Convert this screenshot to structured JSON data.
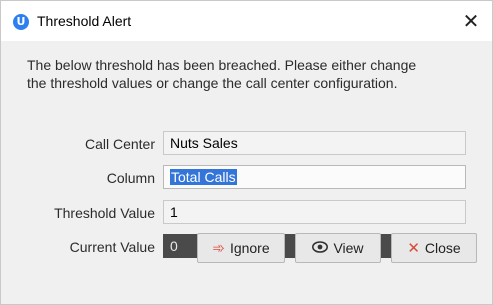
{
  "window": {
    "title": "Threshold Alert",
    "app_icon_letter": "U",
    "close_glyph": "✕"
  },
  "message": {
    "line1": "The below threshold has been breached.  Please either change",
    "line2": "the threshold values or change the call center configuration."
  },
  "fields": {
    "call_center": {
      "label": "Call Center",
      "value": "Nuts Sales"
    },
    "column": {
      "label": "Column",
      "value": "Total Calls"
    },
    "threshold_value": {
      "label": "Threshold Value",
      "value": "1"
    },
    "current_value": {
      "label": "Current Value",
      "value": "0"
    }
  },
  "buttons": {
    "ignore": {
      "label": "Ignore",
      "icon": "ignore-icon"
    },
    "view": {
      "label": "View",
      "icon": "eye-icon"
    },
    "close": {
      "label": "Close",
      "icon": "close-icon"
    }
  },
  "colors": {
    "app_icon": "#2d7ff0",
    "selection": "#3375d8",
    "current_value_field": "#4a4a4a",
    "dialog_background": "#f0f0f0"
  }
}
